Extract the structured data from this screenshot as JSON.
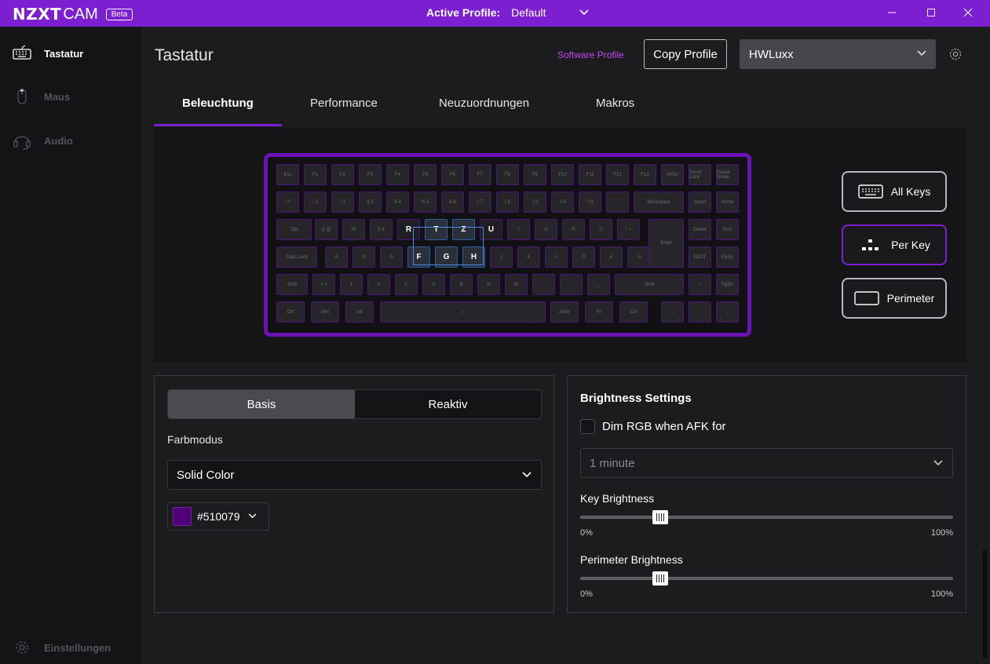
{
  "app": {
    "brand": "NZXT",
    "product": "CAM",
    "badge": "Beta",
    "active_profile_label": "Active Profile:",
    "active_profile_value": "Default"
  },
  "sidebar": {
    "items": [
      {
        "label": "Tastatur",
        "icon": "keyboard-icon",
        "active": true
      },
      {
        "label": "Maus",
        "icon": "mouse-icon",
        "active": false
      },
      {
        "label": "Audio",
        "icon": "headset-icon",
        "active": false
      }
    ],
    "settings_label": "Einstellungen"
  },
  "header": {
    "title": "Tastatur",
    "software_profile": "Software Profile",
    "copy_profile": "Copy Profile",
    "profile_select": "HWLuxx"
  },
  "tabs": [
    "Beleuchtung",
    "Performance",
    "Neuzuordnungen",
    "Makros"
  ],
  "keyboard": {
    "rows": [
      [
        "Esc",
        "F1",
        "F2",
        "F3",
        "F4",
        "F5",
        "F6",
        "F7",
        "F8",
        "F9",
        "F10",
        "F11",
        "F12",
        "F13",
        "PrtSc",
        "Scroll Lock",
        "Pause Break"
      ],
      [
        "°  ^",
        "!  1",
        "\"  2",
        "§  3",
        "$  4",
        "%  5",
        "&  6",
        "/  7",
        "(  8",
        ")  9",
        "=  0",
        "?  ß",
        "`  ´",
        "Backspace",
        "Insert",
        "Home"
      ],
      [
        "Tab",
        "Q  @",
        "W",
        "E  €",
        "R",
        "T",
        "Z",
        "U",
        "I",
        "O",
        "P",
        "Ü",
        "*  +",
        "Enter",
        "Delete",
        "End"
      ],
      [
        "Caps Lock",
        "A",
        "S",
        "D",
        "F",
        "G",
        "H",
        "J",
        "K",
        "L",
        "Ö",
        "Ä",
        "'  #",
        "NZXT",
        "PgUp"
      ],
      [
        "Shift",
        "> <",
        "Y",
        "X",
        "C",
        "V",
        "B",
        "N",
        "M",
        "; ,",
        ": .",
        "_ -",
        "Shift",
        "↑",
        "PgDn"
      ],
      [
        "Ctrl",
        "Win",
        "Alt",
        "—",
        "AltGr",
        "Fn",
        "Ctrl",
        "←",
        "↓",
        "→"
      ]
    ],
    "highlighted": [
      "R",
      "T",
      "Z",
      "U",
      "F",
      "G",
      "H"
    ],
    "frame_color": "#6a12b4"
  },
  "modes": {
    "all_keys": "All Keys",
    "per_key": "Per Key",
    "perimeter": "Perimeter",
    "active": "Per Key"
  },
  "color": {
    "segment_basis": "Basis",
    "segment_reaktiv": "Reaktiv",
    "farbmodus_label": "Farbmodus",
    "farbmodus_value": "Solid Color",
    "hex": "#510079"
  },
  "brightness": {
    "title": "Brightness Settings",
    "dim_label": "Dim RGB when AFK for",
    "dim_checked": false,
    "afk_value": "1 minute",
    "key_label": "Key Brightness",
    "key_value": 0.2,
    "perimeter_label": "Perimeter Brightness",
    "perimeter_value": 0.2,
    "min": "0%",
    "max": "100%"
  },
  "colors": {
    "accent": "#7b1fd1",
    "accent_text": "#c349f0",
    "swatch": "#510079"
  }
}
